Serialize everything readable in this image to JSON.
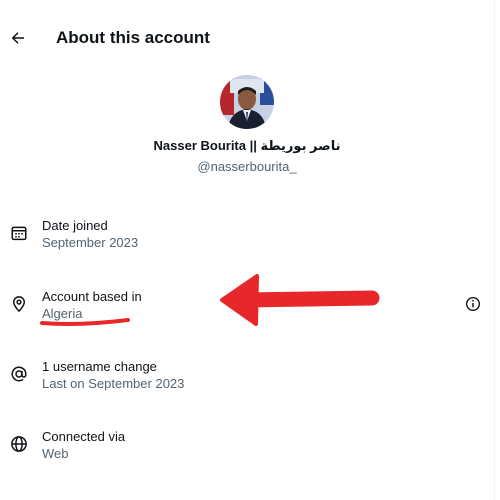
{
  "header": {
    "title": "About this account"
  },
  "profile": {
    "display_name": "Nasser Bourita || ناصر بوريطة",
    "username": "@nasserbourita_"
  },
  "rows": [
    {
      "label": "Date joined",
      "value": "September 2023",
      "icon": "calendar-icon"
    },
    {
      "label": "Account based in",
      "value": "Algeria",
      "icon": "location-pin-icon"
    },
    {
      "label": "1 username change",
      "value": "Last on September 2023",
      "icon": "at-sign-icon"
    },
    {
      "label": "Connected via",
      "value": "Web",
      "icon": "globe-icon"
    }
  ],
  "colors": {
    "text_primary": "#0f1419",
    "text_secondary": "#536471",
    "annotation_red": "#e8272b"
  }
}
